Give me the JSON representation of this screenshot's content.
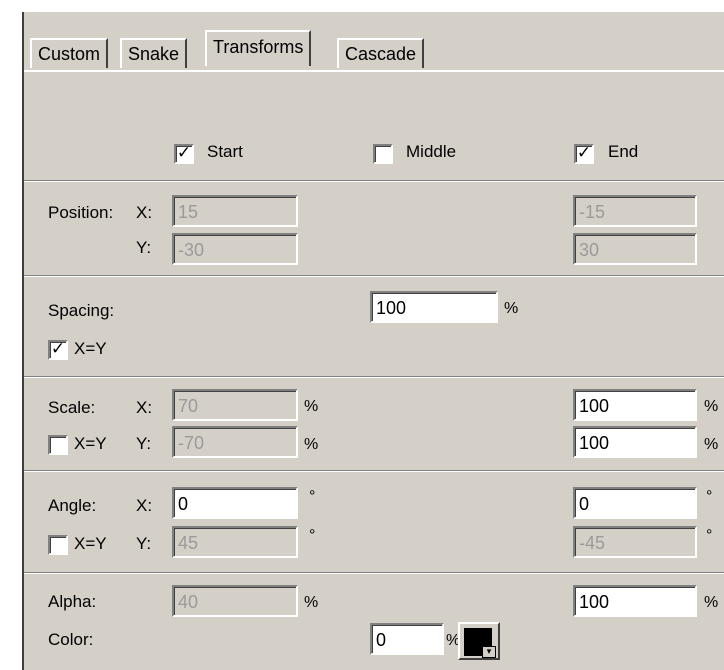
{
  "tabs": [
    "Custom",
    "Snake",
    "Transforms",
    "Cascade"
  ],
  "active_tab": "Transforms",
  "header": {
    "start": {
      "label": "Start",
      "checked": true
    },
    "middle": {
      "label": "Middle",
      "checked": false
    },
    "end": {
      "label": "End",
      "checked": true
    }
  },
  "position": {
    "label": "Position:",
    "x_label": "X:",
    "y_label": "Y:",
    "start_x": "15",
    "start_y": "-30",
    "end_x": "-15",
    "end_y": "30"
  },
  "spacing": {
    "label": "Spacing:",
    "value": "100",
    "unit": "%",
    "xy_label": "X=Y",
    "xy_checked": true
  },
  "scale": {
    "label": "Scale:",
    "x_label": "X:",
    "y_label": "Y:",
    "xy_label": "X=Y",
    "xy_checked": false,
    "start_x": "70",
    "start_y": "-70",
    "end_x": "100",
    "end_y": "100",
    "unit": "%"
  },
  "angle": {
    "label": "Angle:",
    "x_label": "X:",
    "y_label": "Y:",
    "xy_label": "X=Y",
    "xy_checked": false,
    "start_x": "0",
    "start_y": "45",
    "end_x": "0",
    "end_y": "-45",
    "unit": "°"
  },
  "alpha": {
    "label": "Alpha:",
    "start": "40",
    "end": "100",
    "unit": "%"
  },
  "color": {
    "label": "Color:",
    "value": "0",
    "unit": "%",
    "swatch": "#000000"
  },
  "colors": {
    "panel": "#d4d0c8",
    "field_white": "#ffffff",
    "disabled_text": "#9a9a9a"
  }
}
